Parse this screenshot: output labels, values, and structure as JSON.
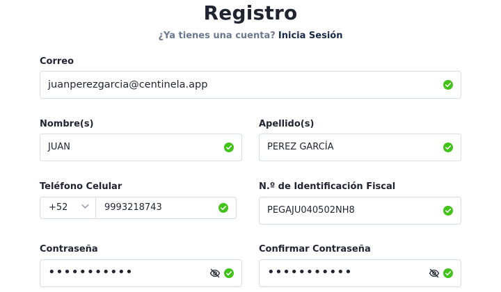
{
  "header": {
    "title": "Registro",
    "subtitle_question": "¿Ya tienes una cuenta?",
    "subtitle_link": "Inicia Sesión"
  },
  "form": {
    "email": {
      "label": "Correo",
      "value": "juanperezgarcia@centinela.app",
      "valid": true
    },
    "first_name": {
      "label": "Nombre(s)",
      "value": "JUAN",
      "valid": true
    },
    "last_name": {
      "label": "Apellido(s)",
      "value": "PEREZ GARCÍA",
      "valid": true
    },
    "phone": {
      "label": "Teléfono Celular",
      "country_code": "+52",
      "value": "9993218743",
      "valid": true
    },
    "tax_id": {
      "label": "N.º de Identificación Fiscal",
      "value": "PEGAJU040502NH8",
      "valid": true
    },
    "password": {
      "label": "Contraseña",
      "value": "•••••••••••",
      "valid": true,
      "visibility_icon": "eye-off-icon"
    },
    "confirm_password": {
      "label": "Confirmar Contraseña",
      "value": "•••••••••••",
      "valid": true,
      "visibility_icon": "eye-off-icon"
    }
  },
  "colors": {
    "valid": "#43c31a",
    "link": "#17294a",
    "muted": "#6b7a90",
    "border": "#d9dee6"
  }
}
